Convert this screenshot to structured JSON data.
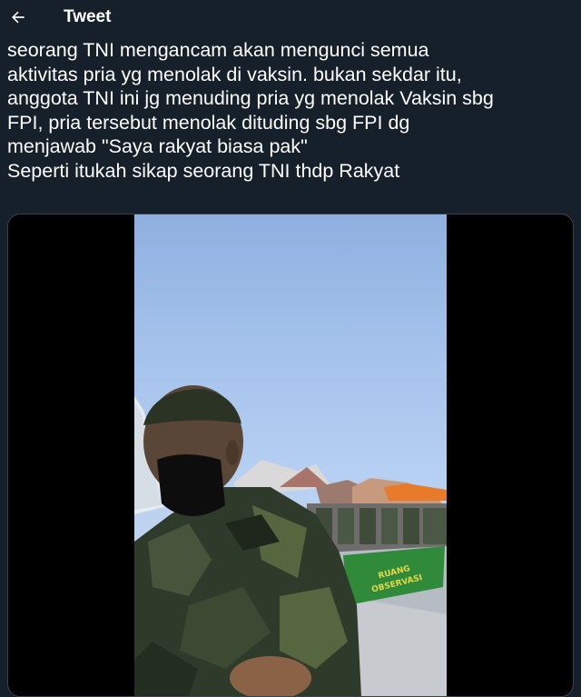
{
  "header": {
    "back_icon": "arrow-left-icon",
    "title": "Tweet"
  },
  "tweet": {
    "text": "seorang TNI mengancam akan mengunci semua\naktivitas pria yg menolak di vaksin. bukan sekdar itu,\nanggota TNI ini jg menuding pria yg menolak Vaksin sbg\nFPI, pria tersebut menolak dituding sbg FPI dg\nmenjawab \"Saya rakyat biasa pak\"\nSeperti itukah sikap seorang TNI thdp Rakyat"
  },
  "media": {
    "type": "video",
    "sign_text_1": "RUANG",
    "sign_text_2": "OBSERVASI"
  },
  "colors": {
    "background": "#15202b",
    "text": "#ffffff",
    "border": "#38444d",
    "sign": "#2f8a3a"
  }
}
